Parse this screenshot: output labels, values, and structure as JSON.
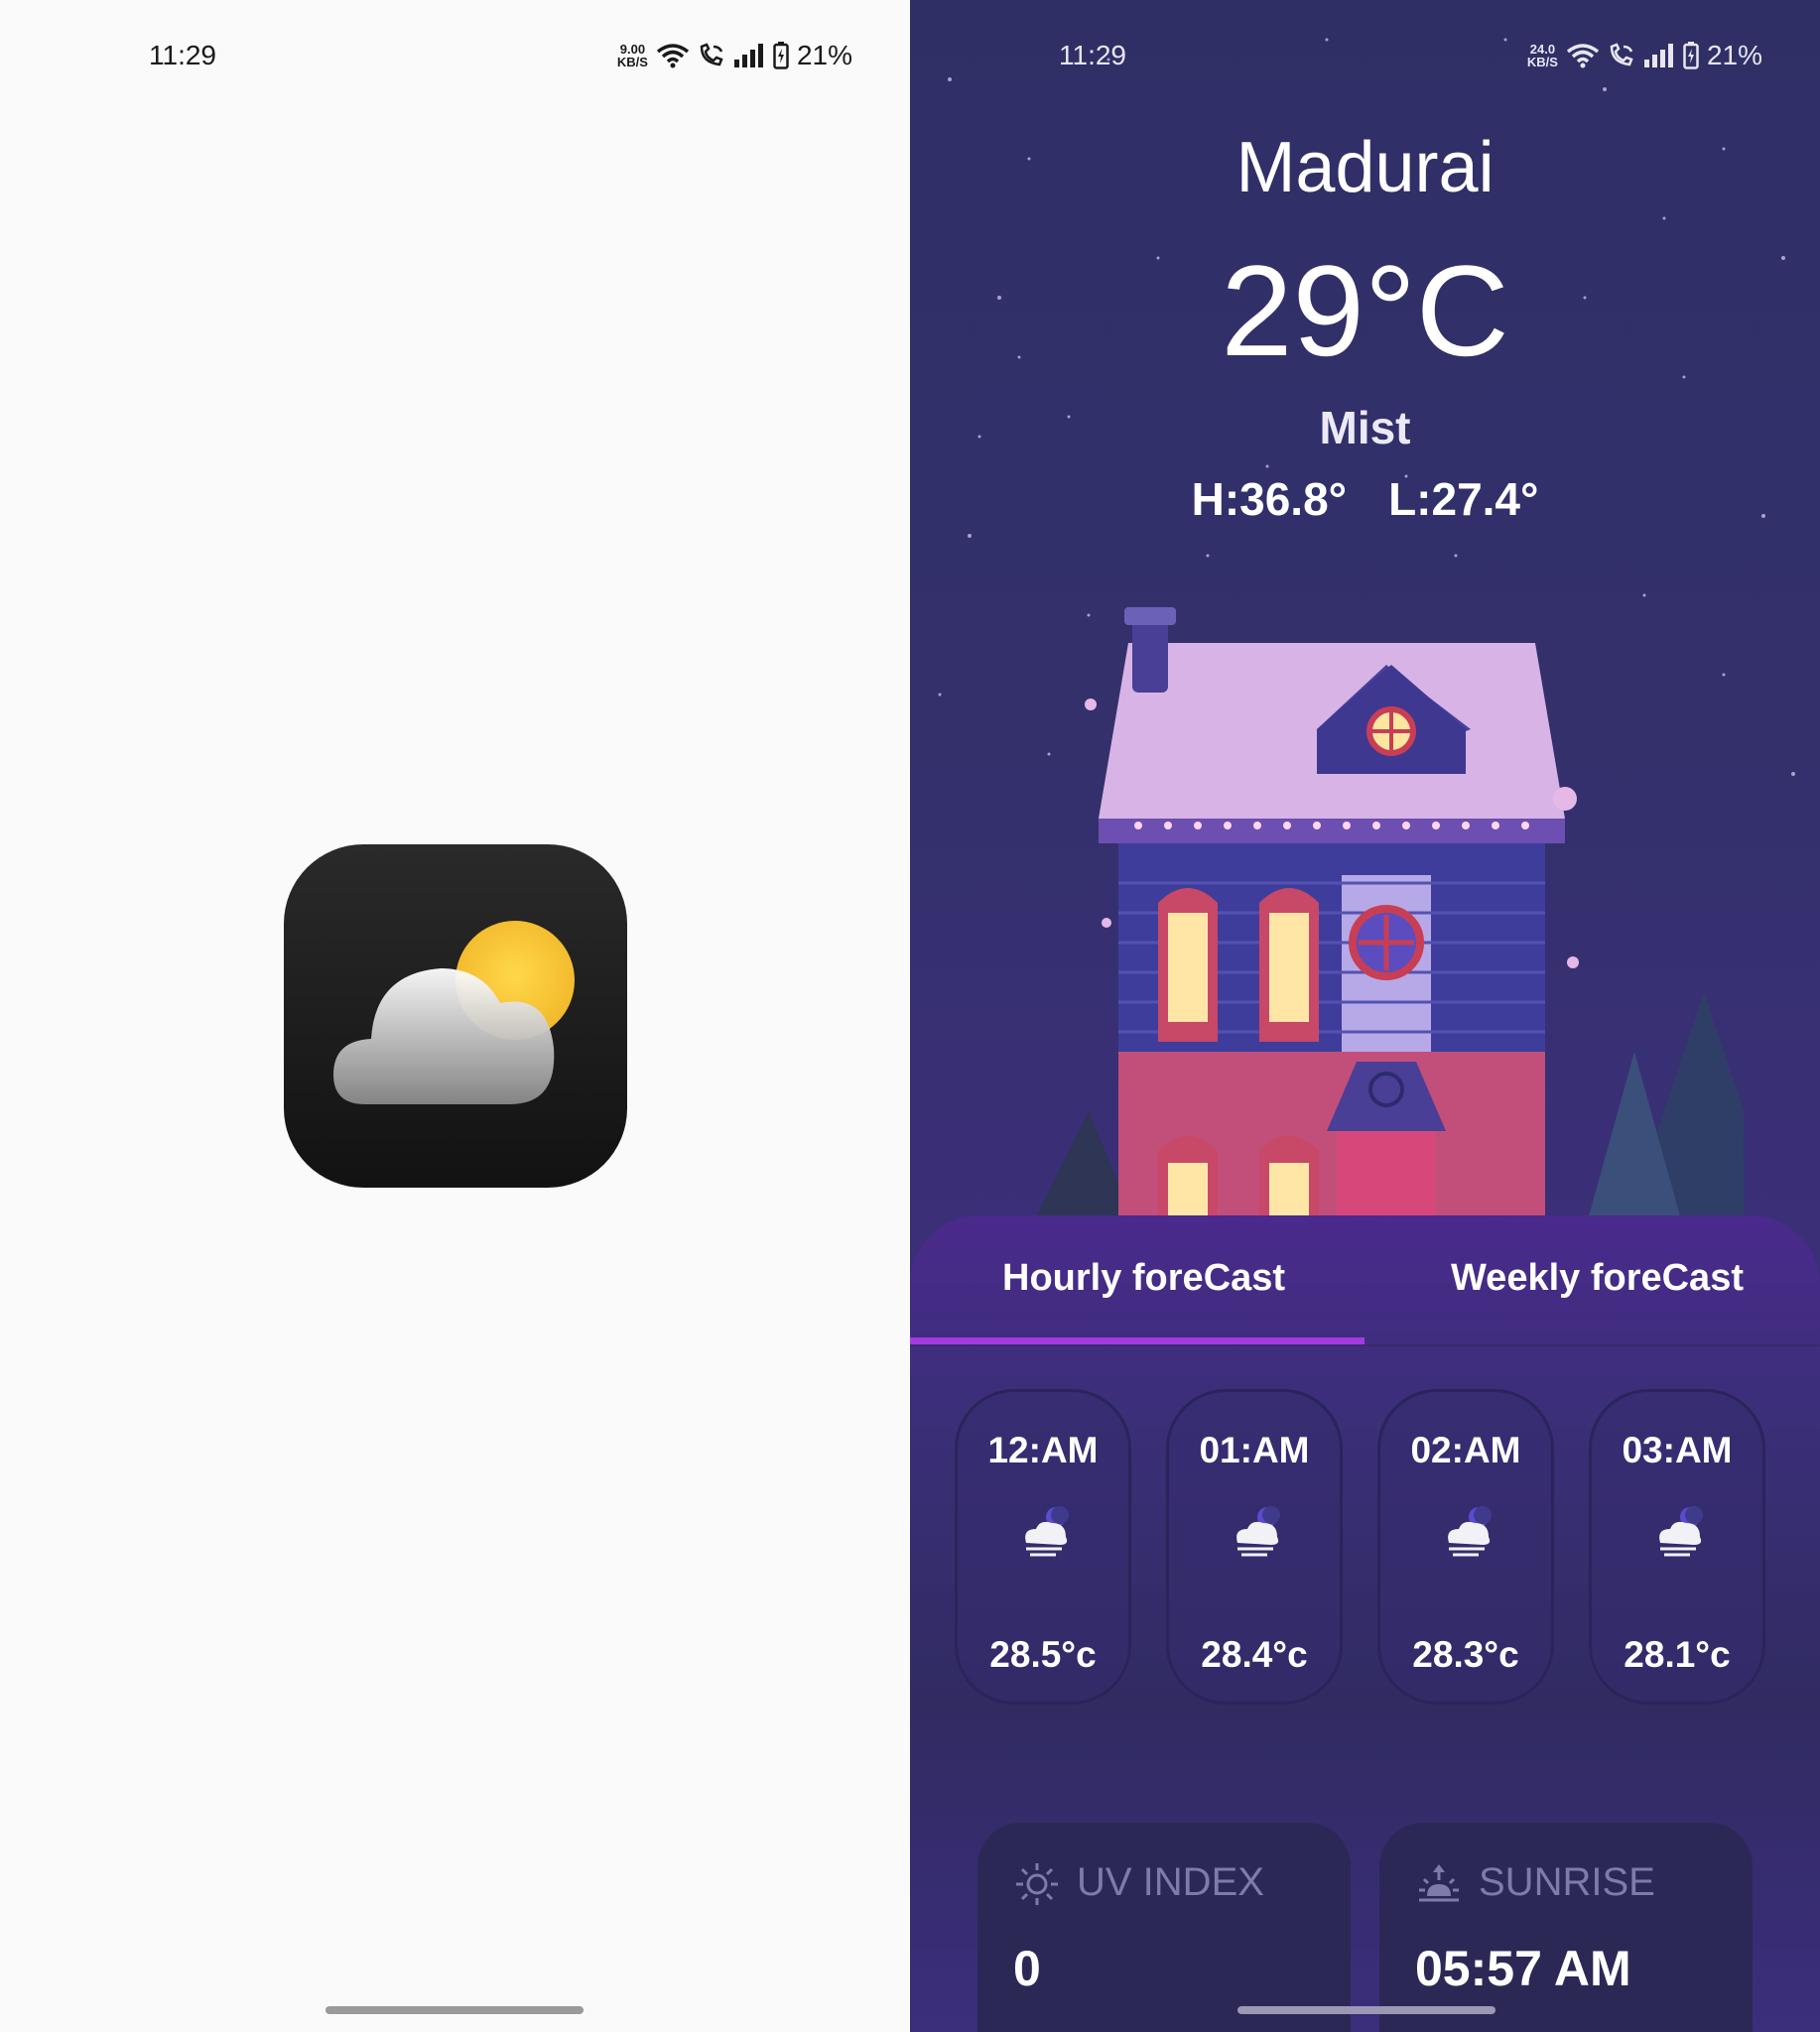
{
  "left_screen": {
    "status_bar": {
      "time": "11:29",
      "net_speed": "9.00",
      "net_unit": "KB/S",
      "battery": "21%"
    },
    "app_icon": "weather-app-icon"
  },
  "right_screen": {
    "status_bar": {
      "time": "11:29",
      "net_speed": "24.0",
      "net_unit": "KB/S",
      "battery": "21%"
    },
    "city": "Madurai",
    "temperature": "29°C",
    "condition": "Mist",
    "high": "H:36.8°",
    "low": "L:27.4°",
    "tabs": [
      {
        "label": "Hourly foreCast",
        "active": true
      },
      {
        "label": "Weekly foreCast",
        "active": false
      }
    ],
    "hourly": [
      {
        "time": "12:AM",
        "temp": "28.5°c",
        "icon": "night-mist-icon"
      },
      {
        "time": "01:AM",
        "temp": "28.4°c",
        "icon": "night-mist-icon"
      },
      {
        "time": "02:AM",
        "temp": "28.3°c",
        "icon": "night-mist-icon"
      },
      {
        "time": "03:AM",
        "temp": "28.1°c",
        "icon": "night-mist-icon"
      }
    ],
    "cards": [
      {
        "label": "UV INDEX",
        "value": "0",
        "icon": "sun-icon"
      },
      {
        "label": "SUNRISE",
        "value": "05:57 AM",
        "icon": "sunrise-icon"
      }
    ],
    "colors": {
      "accent": "#a33be0",
      "sheet": "#4a2a8c"
    }
  }
}
